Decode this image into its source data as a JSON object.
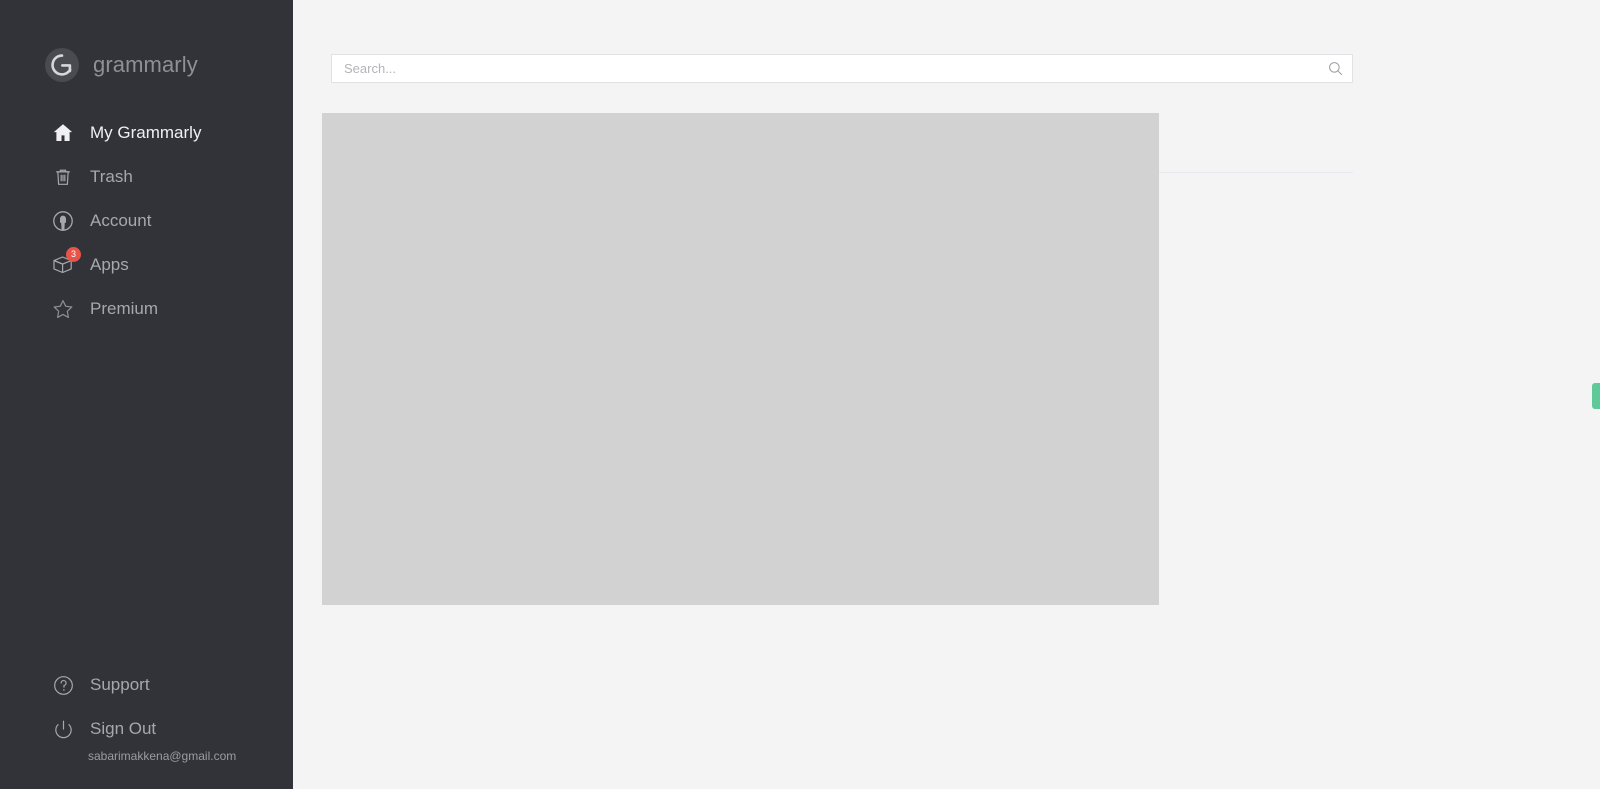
{
  "app": {
    "brand_name": "grammarly",
    "sidebar_bg": "#313338",
    "main_bg": "#f4f4f5",
    "accent_green": "#5fc99a",
    "badge_red": "#e8544a"
  },
  "sidebar": {
    "logo": {
      "icon": "grammarly-g-logo",
      "text": "grammarly"
    },
    "items": [
      {
        "label": "My Grammarly",
        "icon": "home-icon",
        "active": true,
        "badge": ""
      },
      {
        "label": "Trash",
        "icon": "trash-icon",
        "active": false,
        "badge": ""
      },
      {
        "label": "Account",
        "icon": "account-icon",
        "active": false,
        "badge": ""
      },
      {
        "label": "Apps",
        "icon": "apps-cube-icon",
        "active": false,
        "badge": "3"
      },
      {
        "label": "Premium",
        "icon": "star-icon",
        "active": false,
        "badge": ""
      }
    ],
    "footer_items": [
      {
        "label": "Support",
        "icon": "help-circle-icon"
      },
      {
        "label": "Sign Out",
        "icon": "power-icon"
      }
    ],
    "user_email": "sabarimakkena@gmail.com"
  },
  "main": {
    "search": {
      "placeholder": "Search...",
      "value": "",
      "icon": "search-icon"
    },
    "content_placeholder": {
      "label": "loading-content-placeholder"
    },
    "edge_tab": {
      "label": "feedback-tab"
    }
  }
}
